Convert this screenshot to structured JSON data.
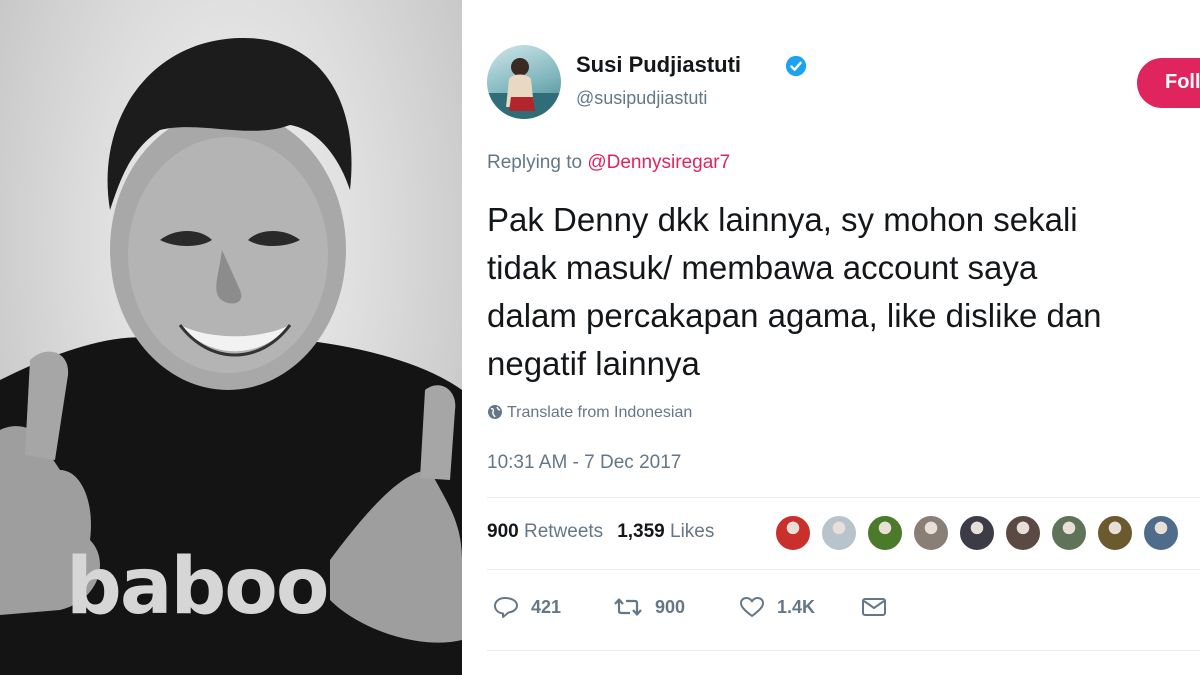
{
  "photo": {
    "shirt_logo": "baboo"
  },
  "tweet": {
    "author": {
      "display_name": "Susi Pudjiastuti",
      "handle": "@susipudjiastuti",
      "verified": true
    },
    "follow_label": "Follow",
    "replying_to_prefix": "Replying to ",
    "replying_to_handle": "@Dennysiregar7",
    "text": "Pak Denny dkk lainnya, sy mohon sekali\ntidak masuk/ membawa account saya\ndalam percakapan agama, like dislike dan\nnegatif lainnya",
    "translate_label": "Translate from Indonesian",
    "timestamp": "10:31 AM - 7 Dec 2017",
    "stats": {
      "retweets_count": "900",
      "retweets_label": "Retweets",
      "likes_count": "1,359",
      "likes_label": "Likes"
    },
    "likers": [
      {
        "icon": "liker-avatar-icon",
        "color": "#c9302c"
      },
      {
        "icon": "default-avatar-icon",
        "color": "#b8c4cc"
      },
      {
        "icon": "liker-avatar-icon",
        "color": "#4a7a2a"
      },
      {
        "icon": "liker-avatar-icon",
        "color": "#8a7f76"
      },
      {
        "icon": "liker-avatar-icon",
        "color": "#3c3c46"
      },
      {
        "icon": "liker-avatar-icon",
        "color": "#5b4a44"
      },
      {
        "icon": "liker-avatar-icon",
        "color": "#5e7358"
      },
      {
        "icon": "liker-avatar-icon",
        "color": "#6b5a2e"
      },
      {
        "icon": "liker-avatar-icon",
        "color": "#4f6d8a"
      }
    ],
    "actions": {
      "reply_count": "421",
      "retweet_count": "900",
      "like_count": "1.4K"
    }
  },
  "colors": {
    "accent": "#e0245e",
    "verified": "#1da1f2",
    "muted": "#657786",
    "text": "#14171a"
  }
}
